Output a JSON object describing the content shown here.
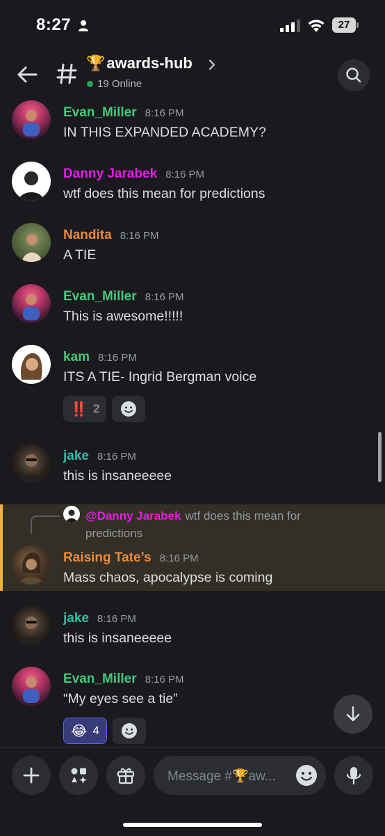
{
  "status_bar": {
    "time": "8:27",
    "battery": "27"
  },
  "header": {
    "channel_emoji": "🏆",
    "channel_name": "awards-hub",
    "online": "19 Online",
    "icons": [
      "back-arrow-icon",
      "hash-icon",
      "chevron-right-icon",
      "search-icon"
    ]
  },
  "messages": [
    {
      "author": "Evan_Miller",
      "time": "8:16 PM",
      "text": "IN THIS EXPANDED ACADEMY?"
    },
    {
      "author": "Danny Jarabek",
      "time": "8:16 PM",
      "text": "wtf does this mean for predictions"
    },
    {
      "author": "Nandita",
      "time": "8:16 PM",
      "text": "A TIE"
    },
    {
      "author": "Evan_Miller",
      "time": "8:16 PM",
      "text": "This is awesome!!!!!"
    },
    {
      "author": "kam",
      "time": "8:16 PM",
      "text": "ITS A TIE- Ingrid Bergman voice",
      "reactions": [
        {
          "emoji": "‼️",
          "count": "2"
        }
      ]
    },
    {
      "author": "jake",
      "time": "8:16 PM",
      "text": "this is insaneeeee"
    },
    {
      "author": "Raising Tate’s",
      "time": "8:16 PM",
      "text": "Mass chaos, apocalypse is coming",
      "reply": {
        "mention": "@Danny Jarabek",
        "text": "wtf does this mean for predictions"
      }
    },
    {
      "author": "jake",
      "time": "8:16 PM",
      "text": "this is insaneeeee"
    },
    {
      "author": "Evan_Miller",
      "time": "8:16 PM",
      "text": "“My eyes see a tie”",
      "reactions": [
        {
          "emoji": "😂",
          "count": "4"
        }
      ]
    }
  ],
  "composer": {
    "placeholder": "Message #🏆aw...",
    "icons": [
      "plus-icon",
      "apps-icon",
      "gift-icon",
      "emoji-icon",
      "microphone-icon"
    ]
  },
  "colors": {
    "background": "#1a1a1e",
    "green_role": "#43c97a",
    "magenta_role": "#e61ee6",
    "orange_role": "#e98a3c",
    "teal_role": "#2ebfa5",
    "highlight_bar": "#f0b232",
    "online": "#23a55a"
  }
}
